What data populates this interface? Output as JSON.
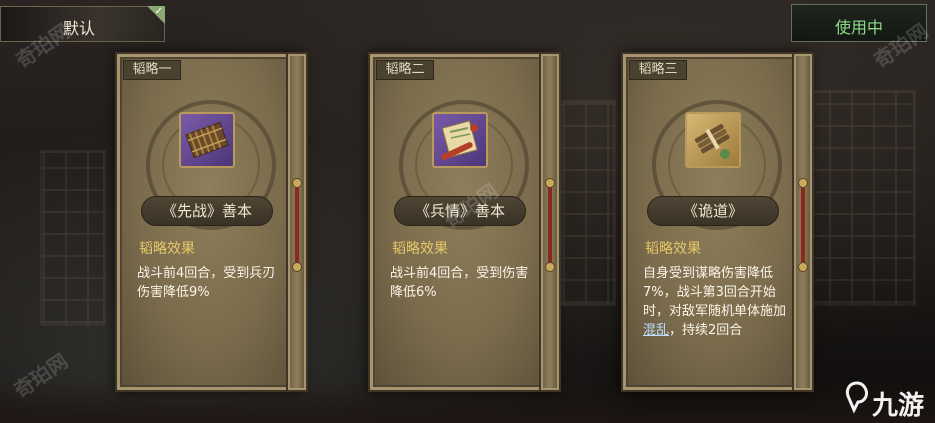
{
  "top_bar": {
    "default_tab": "默认",
    "status_button": "使用中"
  },
  "cards": [
    {
      "tag": "韬略一",
      "name": "《先战》善本",
      "effect_title": "韬略效果",
      "effect_text": "战斗前4回合，受到兵刃伤害降低9%",
      "icon": "bamboo-scroll-icon"
    },
    {
      "tag": "韬略二",
      "name": "《兵情》善本",
      "effect_title": "韬略效果",
      "effect_text": "战斗前4回合，受到伤害降低6%",
      "icon": "paper-scroll-icon"
    },
    {
      "tag": "韬略三",
      "name": "《诡道》",
      "effect_title": "韬略效果",
      "effect_text_before": "自身受到谋略伤害降低7%，战斗第3回合开始时，对敌军随机单体施加",
      "effect_highlight": "混乱",
      "effect_text_after": "，持续2回合",
      "icon": "bamboo-bundle-icon"
    }
  ],
  "watermarks": [
    "奇珀网",
    "奇珀网",
    "奇珀网",
    "奇珀网"
  ],
  "logo": "九游",
  "colors": {
    "status_green": "#8edc8a",
    "effect_title_gold": "#e6c96a",
    "highlight_blue": "#bfe0ff"
  }
}
